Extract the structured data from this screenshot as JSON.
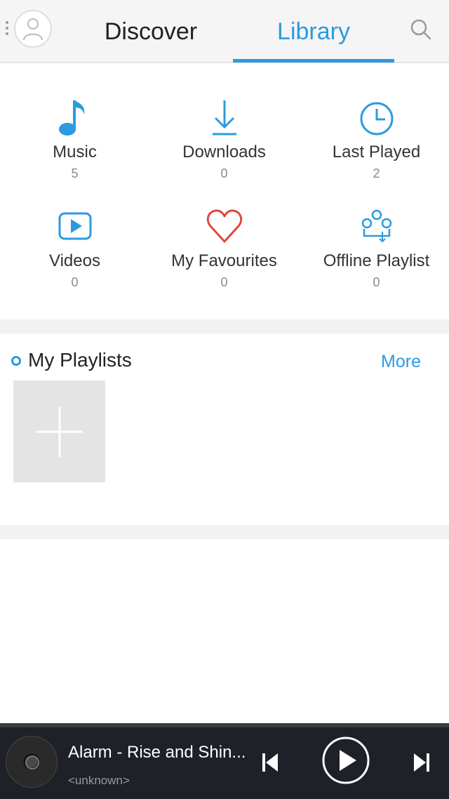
{
  "header": {
    "tabs": [
      {
        "label": "Discover",
        "active": false
      },
      {
        "label": "Library",
        "active": true
      }
    ],
    "accent_color": "#2b9be0",
    "icons": [
      "menu-dots-icon",
      "user-icon",
      "search-icon"
    ]
  },
  "categories": [
    {
      "label": "Music",
      "count": "5",
      "icon": "music-note-icon"
    },
    {
      "label": "Downloads",
      "count": "0",
      "icon": "download-icon"
    },
    {
      "label": "Last Played",
      "count": "2",
      "icon": "clock-icon"
    },
    {
      "label": "Videos",
      "count": "0",
      "icon": "video-play-icon"
    },
    {
      "label": "My Favourites",
      "count": "0",
      "icon": "heart-icon"
    },
    {
      "label": "Offline Playlist",
      "count": "0",
      "icon": "offline-playlist-icon"
    }
  ],
  "playlists": {
    "title": "My Playlists",
    "more_label": "More",
    "add_icon": "plus-icon"
  },
  "player": {
    "title": "Alarm - Rise and Shin...",
    "artist": "<unknown>",
    "icons": [
      "disc-icon",
      "previous-icon",
      "play-icon",
      "next-icon"
    ]
  }
}
